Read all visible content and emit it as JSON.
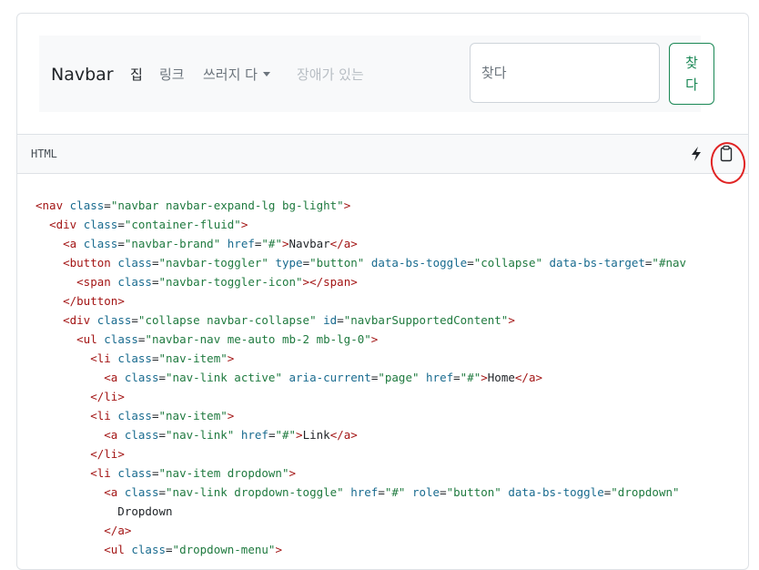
{
  "navbar": {
    "brand": "Navbar",
    "links": [
      {
        "label": "집",
        "state": "active"
      },
      {
        "label": "링크",
        "state": "normal"
      },
      {
        "label": "쓰러지 다",
        "state": "dropdown"
      },
      {
        "label": "장애가 있는",
        "state": "disabled"
      }
    ],
    "search_placeholder": "찾다",
    "search_button": "찾다"
  },
  "code_header": {
    "language": "HTML",
    "icons": [
      "lightning-icon",
      "clipboard-icon"
    ]
  },
  "code_lines": [
    "<nav class=\"navbar navbar-expand-lg bg-light\">",
    "  <div class=\"container-fluid\">",
    "    <a class=\"navbar-brand\" href=\"#\">Navbar</a>",
    "    <button class=\"navbar-toggler\" type=\"button\" data-bs-toggle=\"collapse\" data-bs-target=\"#nav",
    "      <span class=\"navbar-toggler-icon\"></span>",
    "    </button>",
    "    <div class=\"collapse navbar-collapse\" id=\"navbarSupportedContent\">",
    "      <ul class=\"navbar-nav me-auto mb-2 mb-lg-0\">",
    "        <li class=\"nav-item\">",
    "          <a class=\"nav-link active\" aria-current=\"page\" href=\"#\">Home</a>",
    "        </li>",
    "        <li class=\"nav-item\">",
    "          <a class=\"nav-link\" href=\"#\">Link</a>",
    "        </li>",
    "        <li class=\"nav-item dropdown\">",
    "          <a class=\"nav-link dropdown-toggle\" href=\"#\" role=\"button\" data-bs-toggle=\"dropdown\"",
    "            Dropdown",
    "          </a>",
    "          <ul class=\"dropdown-menu\">"
  ]
}
